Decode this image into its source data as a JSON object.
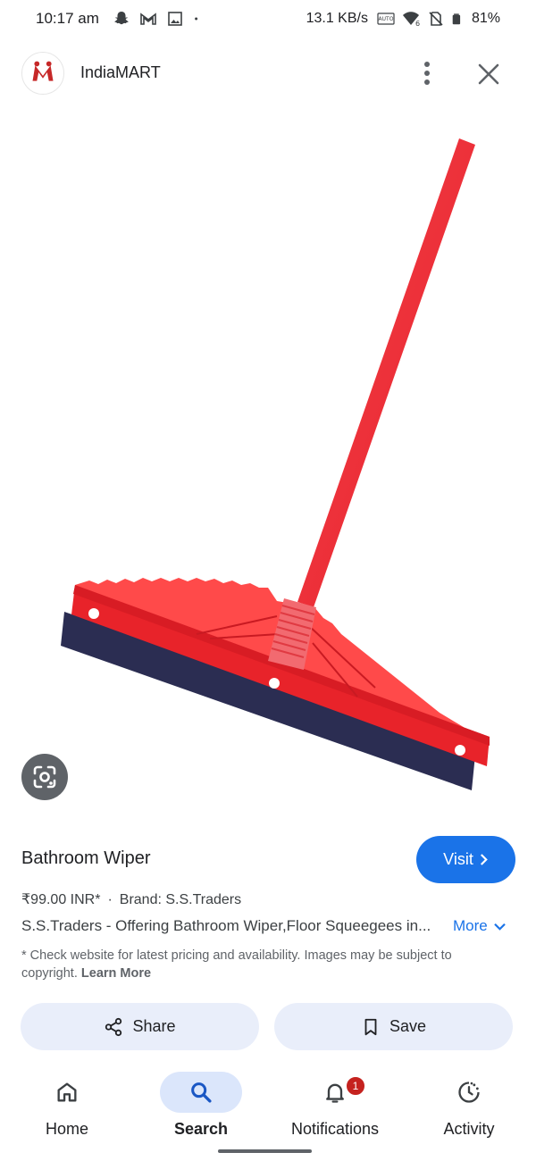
{
  "status_bar": {
    "time": "10:17 am",
    "speed": "13.1 KB/s",
    "battery": "81%",
    "icons_left": [
      "snapchat-icon",
      "gmail-icon",
      "gallery-icon",
      "dot-icon"
    ],
    "icons_right": [
      "auto-network-icon",
      "wifi-6-icon",
      "no-sim-icon",
      "battery-icon"
    ]
  },
  "header": {
    "title": "IndiaMART",
    "logo_letter": "M"
  },
  "product": {
    "title": "Bathroom Wiper",
    "visit_label": "Visit",
    "price": "₹99.00 INR*",
    "brand": "Brand: S.S.Traders",
    "description": "S.S.Traders - Offering Bathroom Wiper,Floor Squeegees in...",
    "more_label": "More",
    "disclaimer": "* Check website for latest pricing and availability. Images may be subject to copyright.",
    "learn_more": "Learn More"
  },
  "actions": {
    "share_label": "Share",
    "save_label": "Save"
  },
  "nav": {
    "home": "Home",
    "search": "Search",
    "notifications": "Notifications",
    "notifications_badge": "1",
    "activity": "Activity"
  },
  "colors": {
    "accent": "#1a73e8",
    "pill_bg": "#e9eefa",
    "wiper_red": "#e8232a",
    "blade": "#2b2d52"
  }
}
